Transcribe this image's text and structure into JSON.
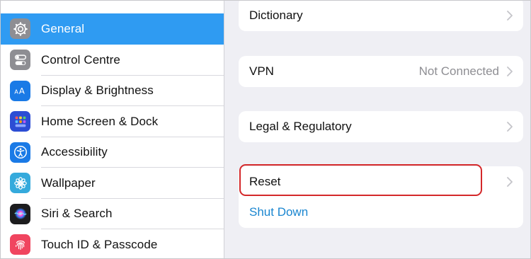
{
  "sidebar": {
    "items": [
      {
        "label": "General",
        "icon": "gear-icon",
        "color": "#8e8e93",
        "selected": true
      },
      {
        "label": "Control Centre",
        "icon": "toggles-icon",
        "color": "#8e8e93",
        "selected": false
      },
      {
        "label": "Display & Brightness",
        "icon": "text-size-icon",
        "color": "#1a7ae6",
        "selected": false
      },
      {
        "label": "Home Screen & Dock",
        "icon": "app-grid-icon",
        "color": "#2c4dd4",
        "selected": false
      },
      {
        "label": "Accessibility",
        "icon": "accessibility-icon",
        "color": "#1a7ae6",
        "selected": false
      },
      {
        "label": "Wallpaper",
        "icon": "flower-icon",
        "color": "#35aadc",
        "selected": false
      },
      {
        "label": "Siri & Search",
        "icon": "siri-icon",
        "color": "#1c1c1e",
        "selected": false
      },
      {
        "label": "Touch ID & Passcode",
        "icon": "fingerprint-icon",
        "color": "#f0455f",
        "selected": false
      }
    ]
  },
  "main": {
    "dictionary_label": "Dictionary",
    "vpn_label": "VPN",
    "vpn_value": "Not Connected",
    "legal_label": "Legal & Regulatory",
    "reset_label": "Reset",
    "shutdown_label": "Shut Down"
  },
  "colors": {
    "selected_bg": "#2f9bf2",
    "link_blue": "#1a86d0",
    "highlight_red": "#d4282a",
    "background": "#efeff4"
  }
}
